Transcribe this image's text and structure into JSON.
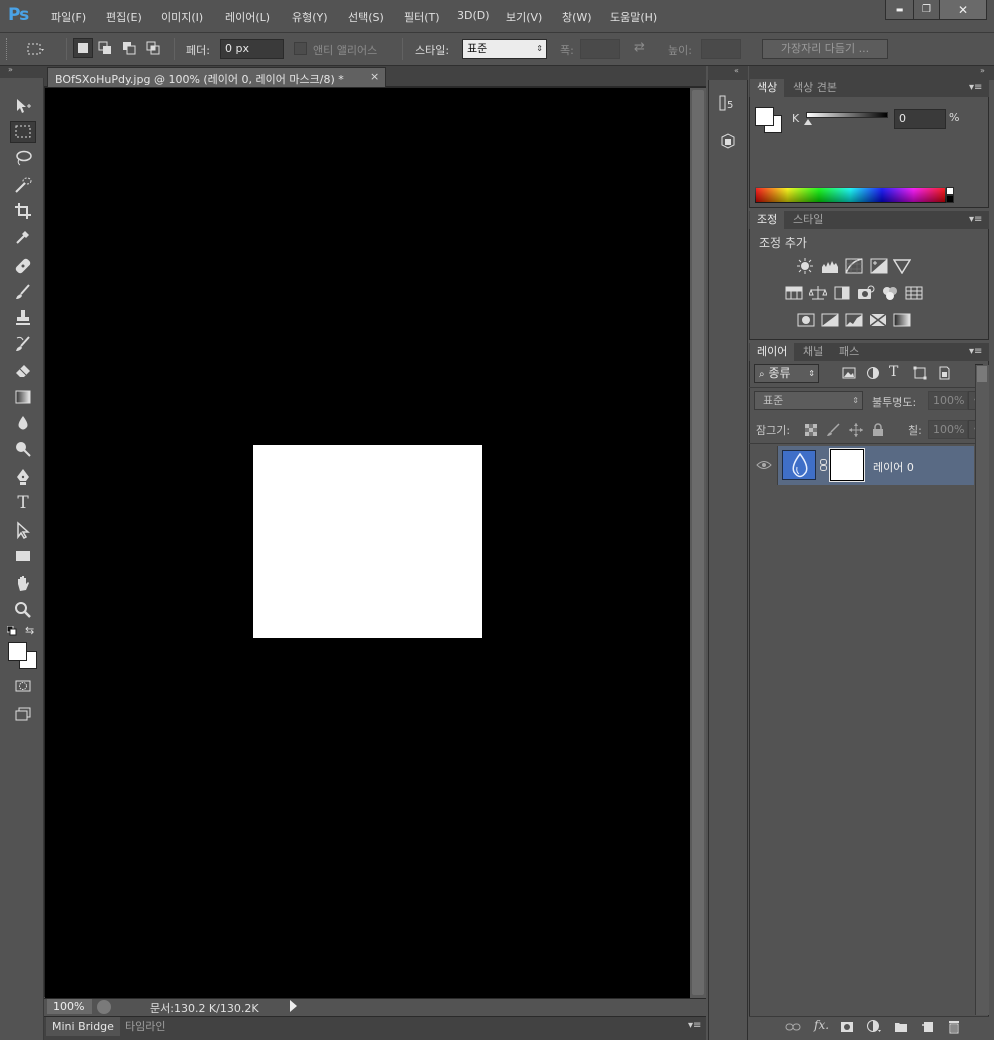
{
  "app": {
    "logo": "Ps"
  },
  "menu": [
    "파일(F)",
    "편집(E)",
    "이미지(I)",
    "레이어(L)",
    "유형(Y)",
    "선택(S)",
    "필터(T)",
    "3D(D)",
    "보기(V)",
    "창(W)",
    "도움말(H)"
  ],
  "window_controls": {
    "minimize": "▬",
    "maximize": "❐",
    "close": "✕"
  },
  "options": {
    "feather_label": "페더:",
    "feather_value": "0 px",
    "antialias_label": "앤티 앨리어스",
    "style_label": "스타일:",
    "style_value": "표준",
    "width_label": "폭:",
    "height_label": "높이:",
    "refine_edge_label": "가장자리 다듬기 ..."
  },
  "document": {
    "tab_title": "BOfSXoHuPdy.jpg @ 100% (레이어 0, 레이어 마스크/8) *",
    "close": "×",
    "zoom": "100%",
    "doc_info": "문서:130.2 K/130.2K"
  },
  "bottom_tabs": [
    "Mini Bridge",
    "타임라인"
  ],
  "color_panel": {
    "tabs": [
      "색상",
      "색상 견본"
    ],
    "channel_label": "K",
    "channel_value": "0",
    "unit": "%"
  },
  "adjustments_panel": {
    "tabs": [
      "조정",
      "스타일"
    ],
    "heading": "조정 추가"
  },
  "layers_panel": {
    "tabs": [
      "레이어",
      "채널",
      "패스"
    ],
    "filter_kind": "종류",
    "blend_mode": "표준",
    "opacity_label": "불투명도:",
    "opacity_value": "100%",
    "lock_label": "잠그기:",
    "fill_label": "칠:",
    "fill_value": "100%",
    "layers": [
      {
        "name": "레이어 0"
      }
    ]
  },
  "colors": {
    "accent_blue": "#4aa3e8",
    "layer_selected": "#596a84",
    "foreground": "#ffffff",
    "background": "#ffffff"
  },
  "icons": [
    "move-icon",
    "marquee-icon",
    "lasso-icon",
    "quick-select-icon",
    "crop-icon",
    "eyedropper-icon",
    "healing-icon",
    "brush-icon",
    "stamp-icon",
    "history-brush-icon",
    "eraser-icon",
    "gradient-icon",
    "blur-icon",
    "dodge-icon",
    "pen-icon",
    "type-icon",
    "path-select-icon",
    "rectangle-icon",
    "hand-icon",
    "zoom-icon",
    "quick-mask-icon",
    "screen-mode-icon"
  ]
}
